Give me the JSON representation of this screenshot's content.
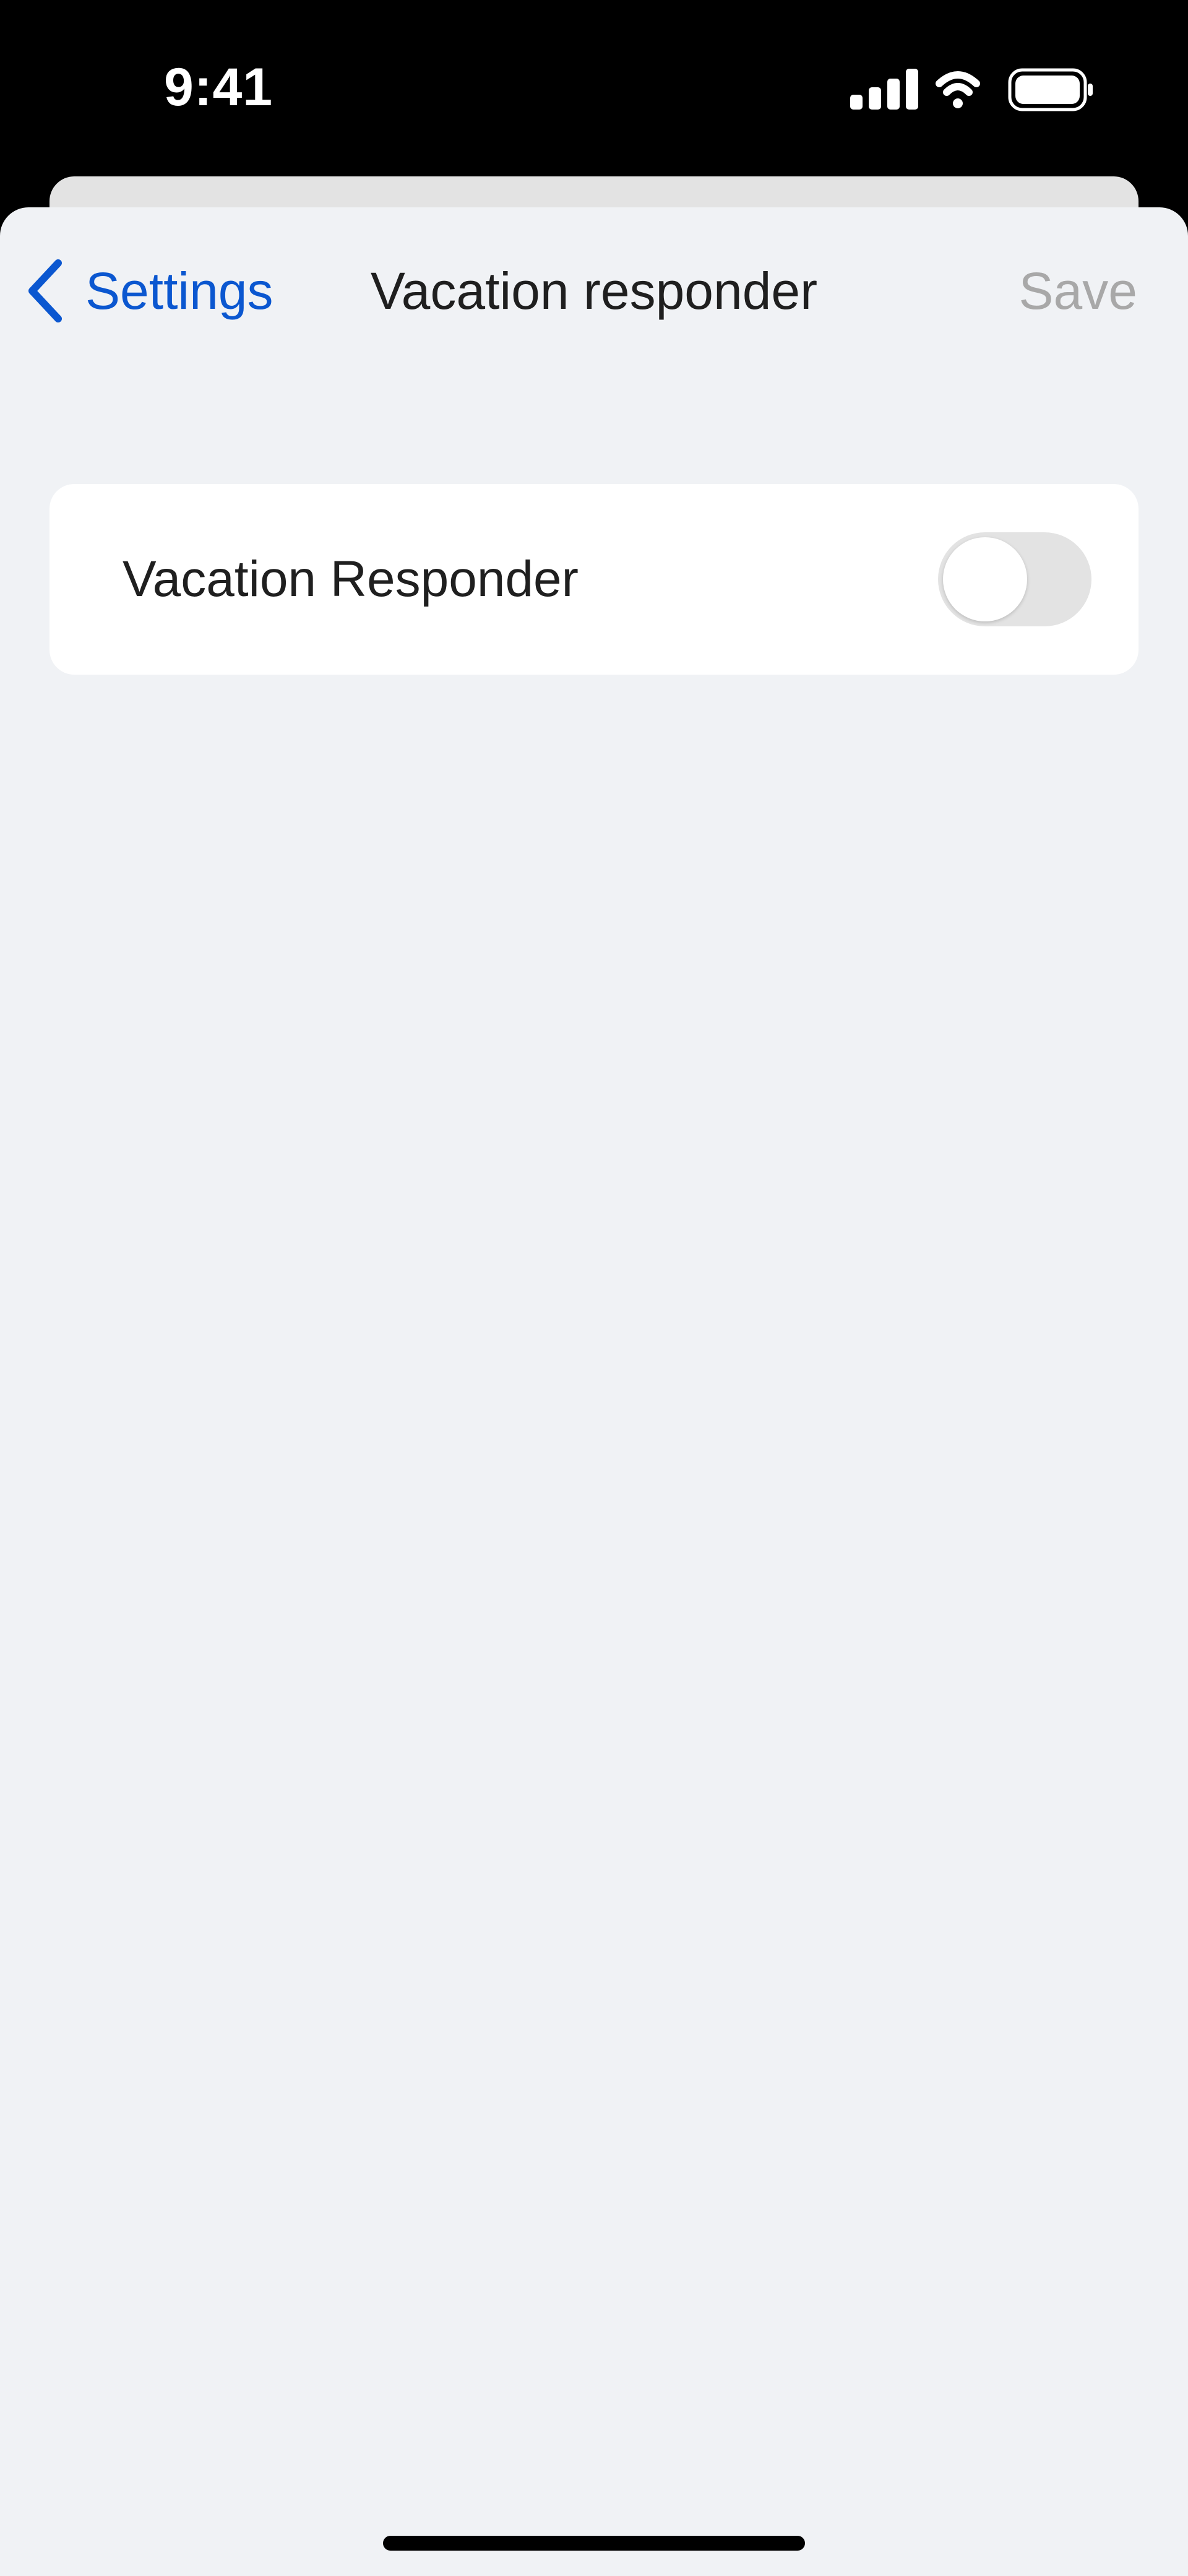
{
  "status_bar": {
    "time": "9:41",
    "icons": [
      "cellular-signal-icon",
      "wifi-icon",
      "battery-icon"
    ]
  },
  "nav": {
    "back_label": "Settings",
    "title": "Vacation responder",
    "save_label": "Save"
  },
  "settings": {
    "vacation_responder": {
      "label": "Vacation Responder",
      "enabled": false
    }
  },
  "colors": {
    "accent": "#0b57d0",
    "background": "#f0f2f5",
    "disabled_text": "#a8a8a8",
    "toggle_off": "#e3e3e3"
  }
}
